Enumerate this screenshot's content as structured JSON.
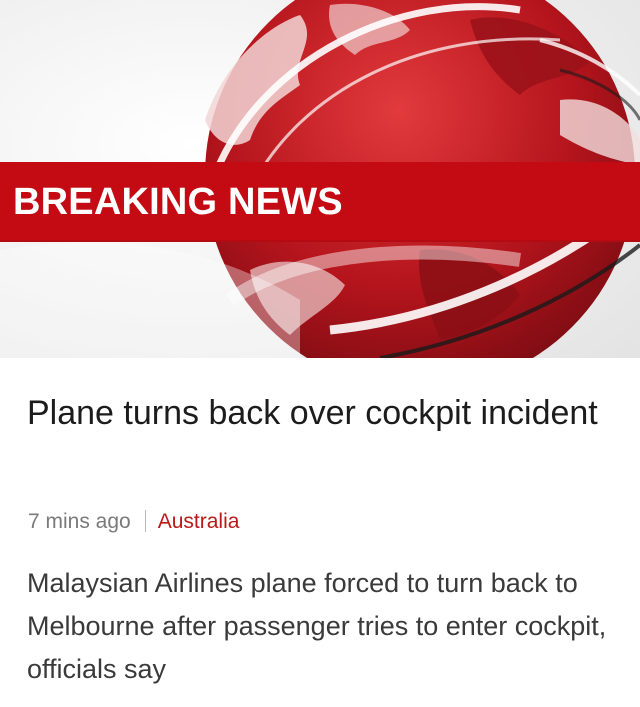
{
  "banner": {
    "label": "BREAKING NEWS",
    "image_icon": "globe-graphic-icon",
    "colors": {
      "banner_red": "#c40b14",
      "globe_red": "#b4141c"
    }
  },
  "article": {
    "headline": "Plane turns back over cockpit incident",
    "timestamp": "7 mins ago",
    "category": "Australia",
    "summary": "Malaysian Airlines plane forced to turn back to Melbourne after passenger tries to enter cockpit, officials say"
  }
}
